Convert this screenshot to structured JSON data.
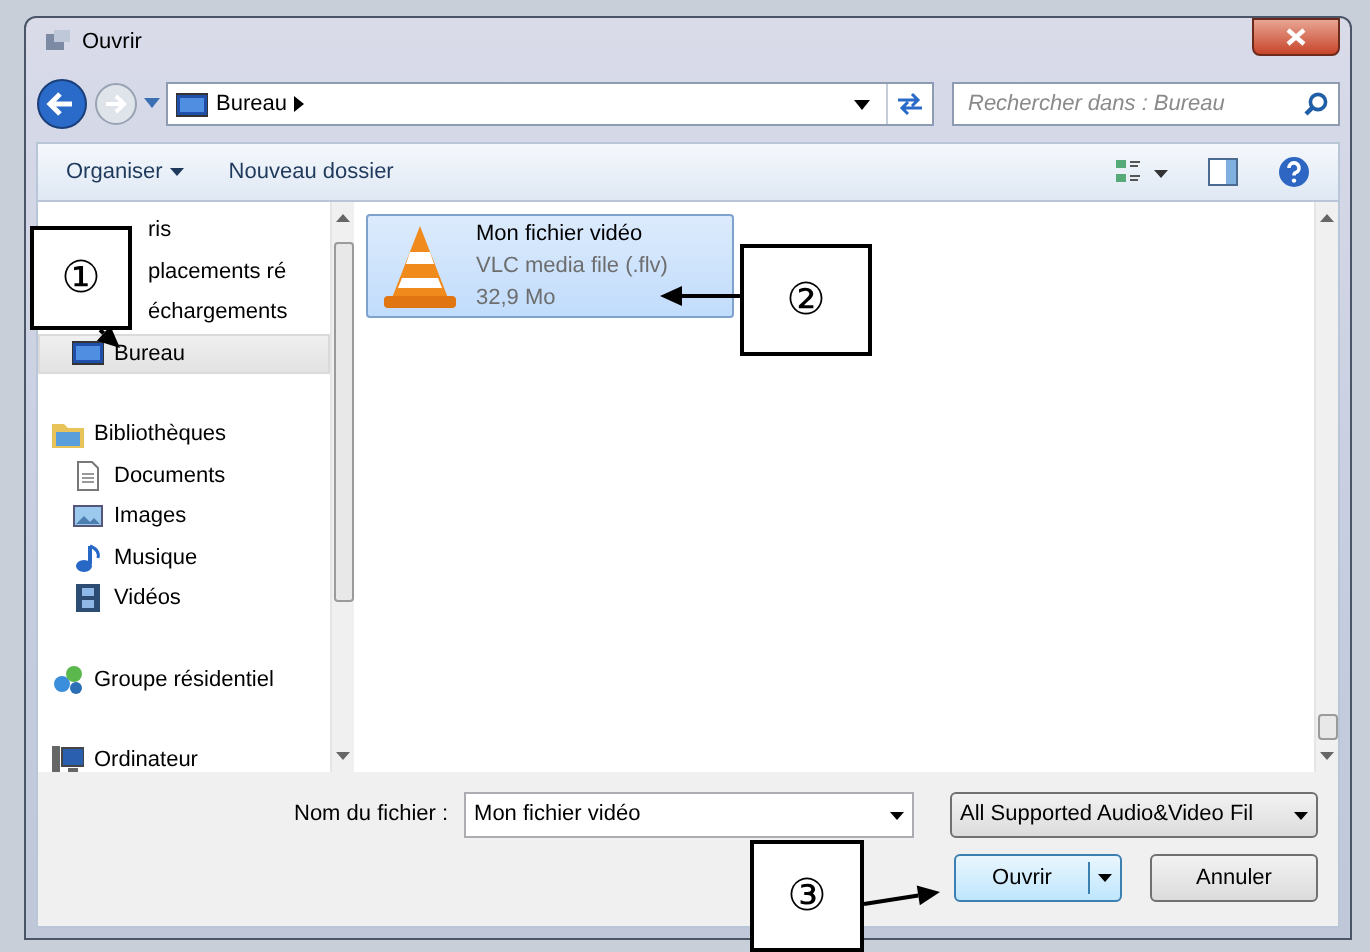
{
  "window": {
    "title": "Ouvrir"
  },
  "address": {
    "breadcrumb": "Bureau",
    "search_placeholder": "Rechercher dans : Bureau"
  },
  "toolbar": {
    "buttons": [
      "Organiser",
      "Nouveau dossier"
    ]
  },
  "sidebar": {
    "groups": [
      {
        "label": "ris",
        "kind": "none",
        "selected": false,
        "children": [
          {
            "label": "placements ré",
            "kind": "none",
            "selected": false
          },
          {
            "label": "échargements",
            "kind": "none",
            "selected": false
          },
          {
            "label": "Bureau",
            "kind": "desktop",
            "selected": true
          }
        ]
      },
      {
        "label": "Bibliothèques",
        "kind": "library",
        "selected": false,
        "children": [
          {
            "label": "Documents",
            "kind": "document",
            "selected": false
          },
          {
            "label": "Images",
            "kind": "image",
            "selected": false
          },
          {
            "label": "Musique",
            "kind": "music",
            "selected": false
          },
          {
            "label": "Vidéos",
            "kind": "video",
            "selected": false
          }
        ]
      },
      {
        "label": "Groupe résidentiel",
        "kind": "homegroup",
        "selected": false
      },
      {
        "label": "Ordinateur",
        "kind": "computer",
        "selected": false
      }
    ]
  },
  "files": [
    {
      "name": "Mon fichier vidéo",
      "type": "VLC media file (.flv)",
      "size": "32,9 Mo",
      "selected": true
    }
  ],
  "footer": {
    "filename_label": "Nom du fichier :",
    "filename": "Mon fichier vidéo",
    "filter": "All Supported Audio&Video Fil",
    "open": "Ouvrir",
    "cancel": "Annuler"
  },
  "callouts": [
    "①",
    "②",
    "③"
  ]
}
